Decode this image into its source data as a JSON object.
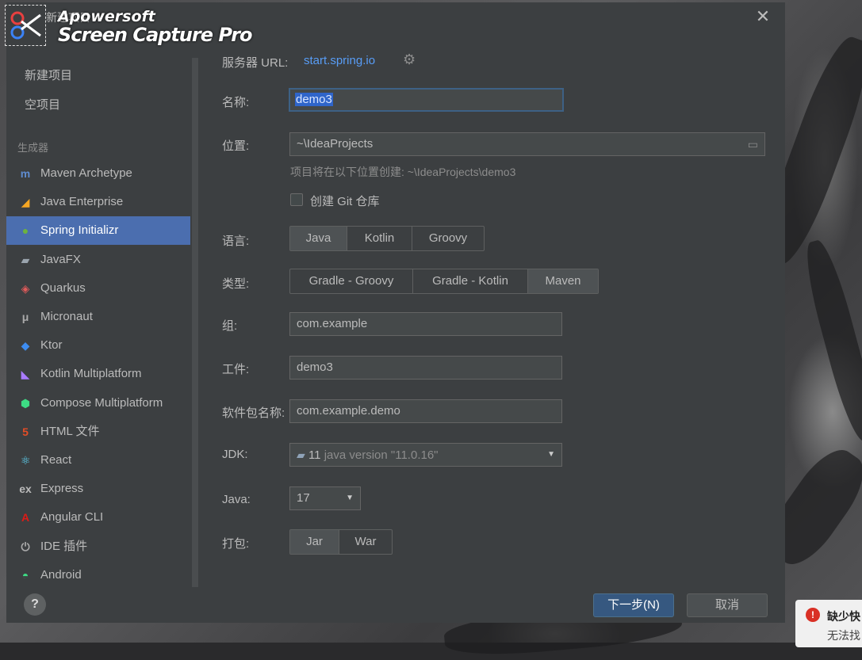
{
  "window": {
    "title": "新建项目",
    "close_glyph": "✕"
  },
  "watermark": {
    "line1": "Apowersoft",
    "line2": "Screen Capture Pro"
  },
  "sidebar": {
    "top_items": [
      {
        "label": "新建项目"
      },
      {
        "label": "空项目"
      }
    ],
    "group_label": "生成器",
    "generators": [
      {
        "label": "Maven Archetype",
        "icon": "maven-icon",
        "glyph": "m",
        "color": "#5f8ccf"
      },
      {
        "label": "Java Enterprise",
        "icon": "java-enterprise-icon",
        "glyph": "◢",
        "color": "#f5a623"
      },
      {
        "label": "Spring Initializr",
        "icon": "spring-icon",
        "glyph": "●",
        "color": "#6db33f",
        "selected": true
      },
      {
        "label": "JavaFX",
        "icon": "javafx-icon",
        "glyph": "▰",
        "color": "#9aa4ad"
      },
      {
        "label": "Quarkus",
        "icon": "quarkus-icon",
        "glyph": "◈",
        "color": "#e05a5a"
      },
      {
        "label": "Micronaut",
        "icon": "micronaut-icon",
        "glyph": "μ",
        "color": "#aaaaaa"
      },
      {
        "label": "Ktor",
        "icon": "ktor-icon",
        "glyph": "◆",
        "color": "#3d8cf0"
      },
      {
        "label": "Kotlin Multiplatform",
        "icon": "kotlin-icon",
        "glyph": "◣",
        "color": "#a97bff"
      },
      {
        "label": "Compose Multiplatform",
        "icon": "compose-icon",
        "glyph": "⬢",
        "color": "#3ddc84"
      },
      {
        "label": "HTML 文件",
        "icon": "html5-icon",
        "glyph": "5",
        "color": "#e44d26"
      },
      {
        "label": "React",
        "icon": "react-icon",
        "glyph": "⚛",
        "color": "#61dafb"
      },
      {
        "label": "Express",
        "icon": "express-icon",
        "glyph": "ex",
        "color": "#bbbbbb"
      },
      {
        "label": "Angular CLI",
        "icon": "angular-icon",
        "glyph": "A",
        "color": "#dd1b16"
      },
      {
        "label": "IDE 插件",
        "icon": "plugin-icon",
        "glyph": "⏻",
        "color": "#aaaaaa"
      },
      {
        "label": "Android",
        "icon": "android-icon",
        "glyph": "◓",
        "color": "#3ddc84"
      }
    ]
  },
  "form": {
    "server_url_label": "服务器 URL:",
    "server_url_value": "start.spring.io",
    "name_label": "名称:",
    "name_value": "demo3",
    "location_label": "位置:",
    "location_value": "~\\IdeaProjects",
    "location_hint": "项目将在以下位置创建: ~\\IdeaProjects\\demo3",
    "git_label": "创建 Git 仓库",
    "language_label": "语言:",
    "languages": [
      "Java",
      "Kotlin",
      "Groovy"
    ],
    "language_selected": "Java",
    "type_label": "类型:",
    "types": [
      "Gradle - Groovy",
      "Gradle - Kotlin",
      "Maven"
    ],
    "type_selected": "Maven",
    "group_label": "组:",
    "group_value": "com.example",
    "artifact_label": "工件:",
    "artifact_value": "demo3",
    "package_label": "软件包名称:",
    "package_value": "com.example.demo",
    "jdk_label": "JDK:",
    "jdk_version": "11",
    "jdk_detail": "java version \"11.0.16\"",
    "java_label": "Java:",
    "java_value": "17",
    "packaging_label": "打包:",
    "packagings": [
      "Jar",
      "War"
    ],
    "packaging_selected": "Jar"
  },
  "footer": {
    "help": "?",
    "next_label": "下一步(N)",
    "cancel_label": "取消"
  },
  "notification": {
    "title": "缺少快",
    "text": "无法找"
  }
}
